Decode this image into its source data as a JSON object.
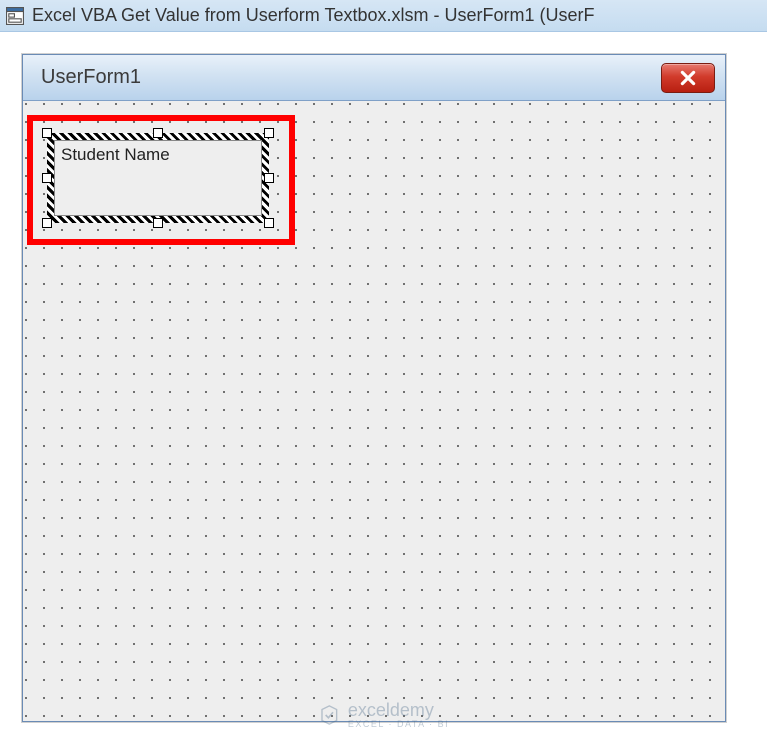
{
  "mainWindow": {
    "title": "Excel VBA Get Value from Userform Textbox.xlsm - UserForm1 (UserF"
  },
  "userform": {
    "title": "UserForm1",
    "label1": {
      "caption": "Student Name"
    }
  },
  "watermark": {
    "brand": "exceldemy",
    "tagline": "EXCEL · DATA · BI"
  }
}
